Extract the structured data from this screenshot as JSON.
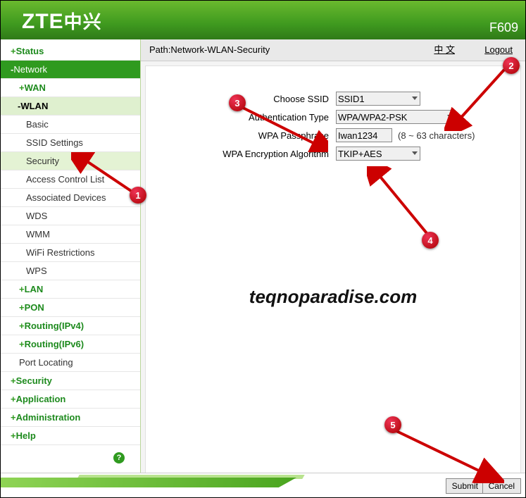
{
  "header": {
    "logo_en": "ZTE",
    "logo_cn": "中兴",
    "model": "F609"
  },
  "pathbar": {
    "label": "Path:Network-WLAN-Security",
    "lang": "中 文",
    "logout": "Logout"
  },
  "sidebar": {
    "status": "Status",
    "network": "Network",
    "wan": "WAN",
    "wlan": "WLAN",
    "wlan_items": {
      "basic": "Basic",
      "ssid_settings": "SSID Settings",
      "security": "Security",
      "acl": "Access Control List",
      "assoc": "Associated Devices",
      "wds": "WDS",
      "wmm": "WMM",
      "wifi_restr": "WiFi Restrictions",
      "wps": "WPS"
    },
    "lan": "LAN",
    "pon": "PON",
    "routing4": "Routing(IPv4)",
    "routing6": "Routing(IPv6)",
    "port_locating": "Port Locating",
    "security": "Security",
    "application": "Application",
    "administration": "Administration",
    "help": "Help",
    "help_icon": "?"
  },
  "form": {
    "ssid_label": "Choose SSID",
    "ssid_value": "SSID1",
    "auth_label": "Authentication Type",
    "auth_value": "WPA/WPA2-PSK",
    "pass_label": "WPA Passphrase",
    "pass_value": "Iwan1234",
    "pass_hint": "(8 ~ 63 characters)",
    "algo_label": "WPA Encryption Algorithm",
    "algo_value": "TKIP+AES"
  },
  "footer": {
    "submit": "Submit",
    "cancel": "Cancel"
  },
  "watermark": "teqnoparadise.com",
  "badges": {
    "b1": "1",
    "b2": "2",
    "b3": "3",
    "b4": "4",
    "b5": "5"
  }
}
